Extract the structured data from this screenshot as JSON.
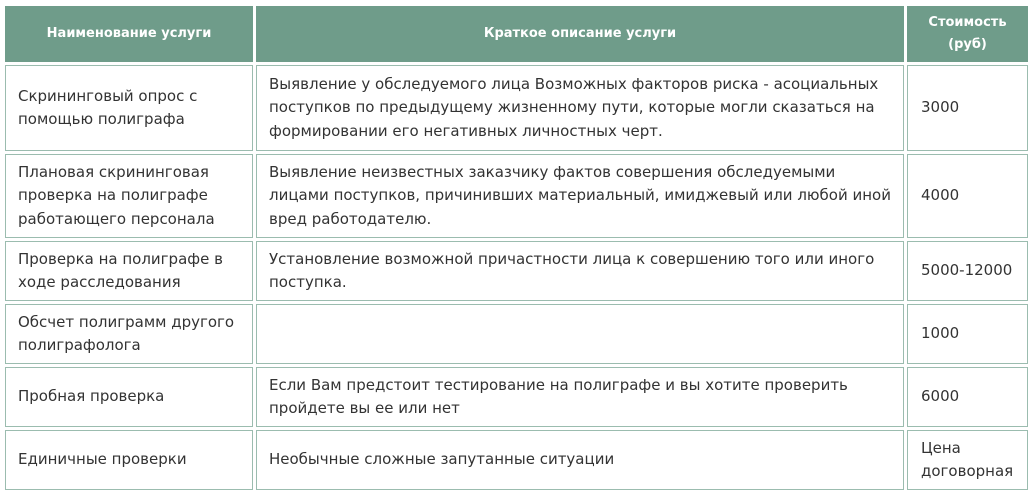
{
  "table": {
    "headers": [
      "Наименование услуги",
      "Краткое описание услуги",
      "Стоимость (руб)"
    ],
    "rows": [
      {
        "service": "Скрининговый опрос с помощью полиграфа",
        "description": "Выявление у обследуемого лица Возможных факторов риска - асоциальных поступков по предыдущему жизненному пути, которые могли сказаться на формировании его негативных личностных черт.",
        "price": "3000"
      },
      {
        "service": "Плановая скрининговая проверка на полиграфе работающего персонала",
        "description": "Выявление неизвестных заказчику фактов совершения обследуемыми лицами поступков, причинивших материальный, имиджевый или любой иной вред работодателю.",
        "price": "4000"
      },
      {
        "service": "Проверка на полиграфе в ходе расследования",
        "description": "Установление возможной причастности лица к совершению того или иного поступка.",
        "price": "5000-12000"
      },
      {
        "service": "Обсчет полиграмм другого полиграфолога",
        "description": "",
        "price": "1000"
      },
      {
        "service": "Пробная проверка",
        "description": "Если Вам предстоит тестирование на полиграфе и вы хотите проверить пройдете вы ее или нет",
        "price": "6000"
      },
      {
        "service": "Единичные проверки",
        "description": "Необычные сложные запутанные ситуации",
        "price": "Цена договорная"
      }
    ]
  },
  "colors": {
    "header_bg": "#6f9c8a",
    "header_text": "#ffffff",
    "border": "#9bbcaf",
    "body_text": "#333333"
  }
}
